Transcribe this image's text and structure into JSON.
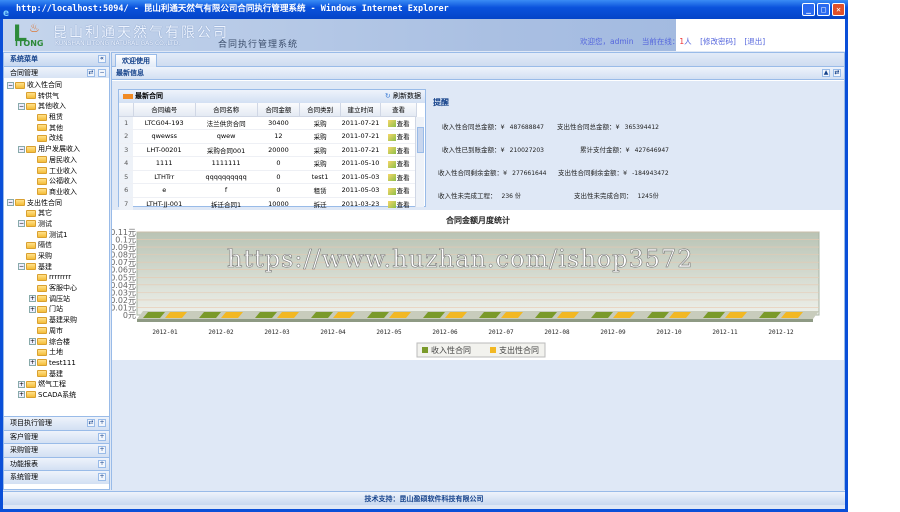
{
  "window": {
    "title": "http://localhost:5094/ - 昆山利通天然气有限公司合同执行管理系统 - Windows Internet Explorer"
  },
  "header": {
    "logo_cn": "昆山利通天然气有限公司",
    "logo_en": "KUNSHAN LITONG NATURAL GAS CO.,LTD.",
    "logo_itong": "ITONG",
    "logo_c": "L",
    "system_name": "合同执行管理系统",
    "welcome": "欢迎您，admin",
    "online_label": "当前在线：",
    "online_count": "1",
    "online_unit": "人",
    "change_password": "[修改密码]",
    "logout": "[退出]"
  },
  "sidebar": {
    "title": "系统菜单",
    "section": "合同管理",
    "tree": [
      {
        "label": "收入性合同",
        "level": 0,
        "toggle": "-"
      },
      {
        "label": "转供气",
        "level": 1
      },
      {
        "label": "其他收入",
        "level": 1,
        "toggle": "-"
      },
      {
        "label": "租赁",
        "level": 2
      },
      {
        "label": "其他",
        "level": 2
      },
      {
        "label": "改线",
        "level": 2
      },
      {
        "label": "用户发展收入",
        "level": 1,
        "toggle": "-"
      },
      {
        "label": "居民收入",
        "level": 2
      },
      {
        "label": "工业收入",
        "level": 2
      },
      {
        "label": "公福收入",
        "level": 2
      },
      {
        "label": "商业收入",
        "level": 2
      },
      {
        "label": "支出性合同",
        "level": 0,
        "toggle": "-"
      },
      {
        "label": "其它",
        "level": 1
      },
      {
        "label": "测试",
        "level": 1,
        "toggle": "-"
      },
      {
        "label": "测试1",
        "level": 2
      },
      {
        "label": "隔信",
        "level": 1
      },
      {
        "label": "采购",
        "level": 1
      },
      {
        "label": "基建",
        "level": 1,
        "toggle": "-"
      },
      {
        "label": "rrrrrrrr",
        "level": 2
      },
      {
        "label": "客服中心",
        "level": 2
      },
      {
        "label": "调压站",
        "level": 2,
        "toggle": "+"
      },
      {
        "label": "门站",
        "level": 2,
        "toggle": "+"
      },
      {
        "label": "基建采购",
        "level": 2
      },
      {
        "label": "周市",
        "level": 2
      },
      {
        "label": "综合楼",
        "level": 2,
        "toggle": "+"
      },
      {
        "label": "土地",
        "level": 2
      },
      {
        "label": "test111",
        "level": 2,
        "toggle": "+"
      },
      {
        "label": "基建",
        "level": 2
      },
      {
        "label": "燃气工程",
        "level": 1,
        "toggle": "+"
      },
      {
        "label": "SCADA系统",
        "level": 1,
        "toggle": "+"
      }
    ],
    "accordion": [
      "项目执行管理",
      "客户管理",
      "采购管理",
      "功能报表",
      "系统管理"
    ]
  },
  "main": {
    "tab": "欢迎使用",
    "info_title": "最新信息",
    "contracts": {
      "title": "最新合同",
      "refresh": "刷新数据",
      "columns": [
        "合同编号",
        "合同名称",
        "合同金额",
        "合同类别",
        "建立时间",
        "查看"
      ],
      "rows": [
        [
          "1",
          "LTCG04-193",
          "法兰供货合同",
          "30400",
          "采购",
          "2011-07-21",
          "查看"
        ],
        [
          "2",
          "qwewss",
          "qwew",
          "12",
          "采购",
          "2011-07-21",
          "查看"
        ],
        [
          "3",
          "LHT-00201",
          "采购合同001",
          "20000",
          "采购",
          "2011-07-21",
          "查看"
        ],
        [
          "4",
          "1111",
          "1111111",
          "0",
          "采购",
          "2011-05-10",
          "查看"
        ],
        [
          "5",
          "LTHTrr",
          "qqqqqqqqqq",
          "0",
          "test1",
          "2011-05-03",
          "查看"
        ],
        [
          "6",
          "e",
          "f",
          "0",
          "租赁",
          "2011-05-03",
          "查看"
        ],
        [
          "7",
          "LTHT-JJ-001",
          "拆迁合同1",
          "10000",
          "拆迁",
          "2011-03-23",
          "查看"
        ]
      ]
    },
    "reminder": {
      "title": "提醒",
      "items": [
        {
          "label": "收入性合同总金额：¥",
          "value": "487688847"
        },
        {
          "label": "支出性合同总金额：¥",
          "value": "365394412"
        },
        {
          "label": "收入性已到账金额：¥",
          "value": "210027203"
        },
        {
          "label": "累计支付金额：¥",
          "value": "427646947"
        },
        {
          "label": "收入性合同剩余金额：¥",
          "value": "277661644"
        },
        {
          "label": "支出性合同剩余金额：¥",
          "value": "-184943472"
        },
        {
          "label": "收入性未完成工程：",
          "value": "236 份"
        },
        {
          "label": "支出性未完成合同：",
          "value": "1245份"
        }
      ]
    }
  },
  "chart_data": {
    "type": "bar",
    "title": "合同金额月度统计",
    "categories": [
      "2012-01",
      "2012-02",
      "2012-03",
      "2012-04",
      "2012-05",
      "2012-06",
      "2012-07",
      "2012-08",
      "2012-09",
      "2012-10",
      "2012-11",
      "2012-12"
    ],
    "series": [
      {
        "name": "收入性合同",
        "color": "#7a9a2a",
        "values": [
          0,
          0,
          0,
          0,
          0,
          0,
          0,
          0,
          0,
          0,
          0,
          0
        ]
      },
      {
        "name": "支出性合同",
        "color": "#f2b824",
        "values": [
          0,
          0,
          0,
          0,
          0,
          0,
          0,
          0,
          0,
          0,
          0,
          0
        ]
      }
    ],
    "yticks": [
      "0元",
      "0.01元",
      "0.02元",
      "0.03元",
      "0.04元",
      "0.05元",
      "0.06元",
      "0.07元",
      "0.08元",
      "0.09元",
      "0.1元",
      "0.11元"
    ],
    "ylim": [
      0,
      0.11
    ],
    "legend": "bottom",
    "grid": true
  },
  "watermark": "https://www.huzhan.com/ishop3572",
  "footer": "技术支持：昆山盈硕软件科技有限公司"
}
